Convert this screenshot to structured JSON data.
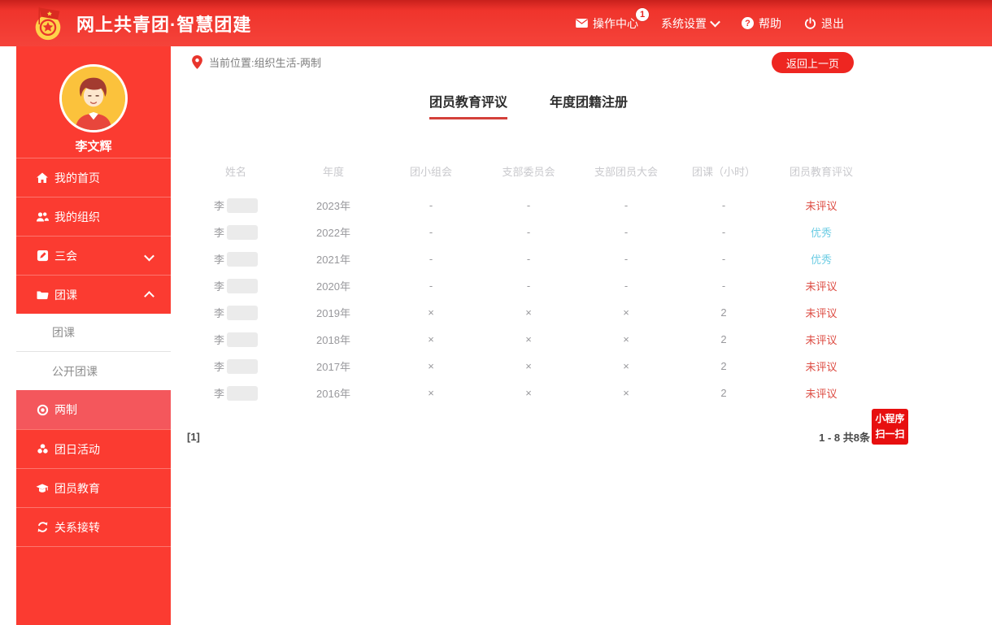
{
  "header": {
    "title": "网上共青团·智慧团建",
    "logo_icon": "communist-youth-league-emblem",
    "nav": {
      "action_center": "操作中心",
      "action_center_icon": "mail-icon",
      "action_center_badge": "1",
      "system_settings": "系统设置",
      "system_settings_icon": "chevron-down-icon",
      "help": "帮助",
      "help_icon": "question-icon",
      "logout": "退出",
      "logout_icon": "power-icon"
    }
  },
  "sidebar": {
    "username": "李文辉",
    "menu": [
      {
        "label": "我的首页",
        "icon": "home-icon"
      },
      {
        "label": "我的组织",
        "icon": "users-icon"
      },
      {
        "label": "三会",
        "icon": "edit-icon",
        "chevron": "down"
      },
      {
        "label": "团课",
        "icon": "folder-icon",
        "chevron": "up",
        "expanded": true
      },
      {
        "label": "两制",
        "icon": "target-icon",
        "active": true
      },
      {
        "label": "团日活动",
        "icon": "recycle-icon"
      },
      {
        "label": "团员教育",
        "icon": "graduation-cap-icon"
      },
      {
        "label": "关系接转",
        "icon": "sync-icon"
      }
    ],
    "submenu": [
      "团课",
      "公开团课"
    ]
  },
  "main": {
    "breadcrumb": "当前位置:组织生活-两制",
    "breadcrumb_icon": "location-pin-icon",
    "back_button": "返回上一页",
    "tabs": [
      {
        "label": "团员教育评议",
        "active": true
      },
      {
        "label": "年度团籍注册",
        "active": false
      }
    ],
    "table": {
      "columns": [
        "姓名",
        "年度",
        "团小组会",
        "支部委员会",
        "支部团员大会",
        "团课（小时）",
        "团员教育评议"
      ],
      "rows": [
        {
          "name": "李",
          "year": "2023年",
          "group_meeting": "-",
          "committee": "-",
          "branch_meeting": "-",
          "class_hours": "-",
          "evaluation": "未评议"
        },
        {
          "name": "李",
          "year": "2022年",
          "group_meeting": "-",
          "committee": "-",
          "branch_meeting": "-",
          "class_hours": "-",
          "evaluation": "优秀"
        },
        {
          "name": "李",
          "year": "2021年",
          "group_meeting": "-",
          "committee": "-",
          "branch_meeting": "-",
          "class_hours": "-",
          "evaluation": "优秀"
        },
        {
          "name": "李",
          "year": "2020年",
          "group_meeting": "-",
          "committee": "-",
          "branch_meeting": "-",
          "class_hours": "-",
          "evaluation": "未评议"
        },
        {
          "name": "李",
          "year": "2019年",
          "group_meeting": "×",
          "committee": "×",
          "branch_meeting": "×",
          "class_hours": "2",
          "evaluation": "未评议"
        },
        {
          "name": "李",
          "year": "2018年",
          "group_meeting": "×",
          "committee": "×",
          "branch_meeting": "×",
          "class_hours": "2",
          "evaluation": "未评议"
        },
        {
          "name": "李",
          "year": "2017年",
          "group_meeting": "×",
          "committee": "×",
          "branch_meeting": "×",
          "class_hours": "2",
          "evaluation": "未评议"
        },
        {
          "name": "李",
          "year": "2016年",
          "group_meeting": "×",
          "committee": "×",
          "branch_meeting": "×",
          "class_hours": "2",
          "evaluation": "未评议"
        }
      ]
    },
    "pagination": {
      "page": "[1]",
      "summary": "1 - 8  共8条"
    }
  },
  "floating_badge": {
    "line1": "小程序",
    "line2": "扫一扫"
  },
  "colors": {
    "header_red": "#f1302b",
    "sidebar_red": "#fb3b31",
    "active_item_red": "#f4575c",
    "button_red": "#ee2621",
    "mini_badge_red": "#e70f0f",
    "tab_underline_red": "#d4403a",
    "evaluation_pending_red": "#dd4b42",
    "evaluation_excellent_blue": "#6ecde4"
  }
}
